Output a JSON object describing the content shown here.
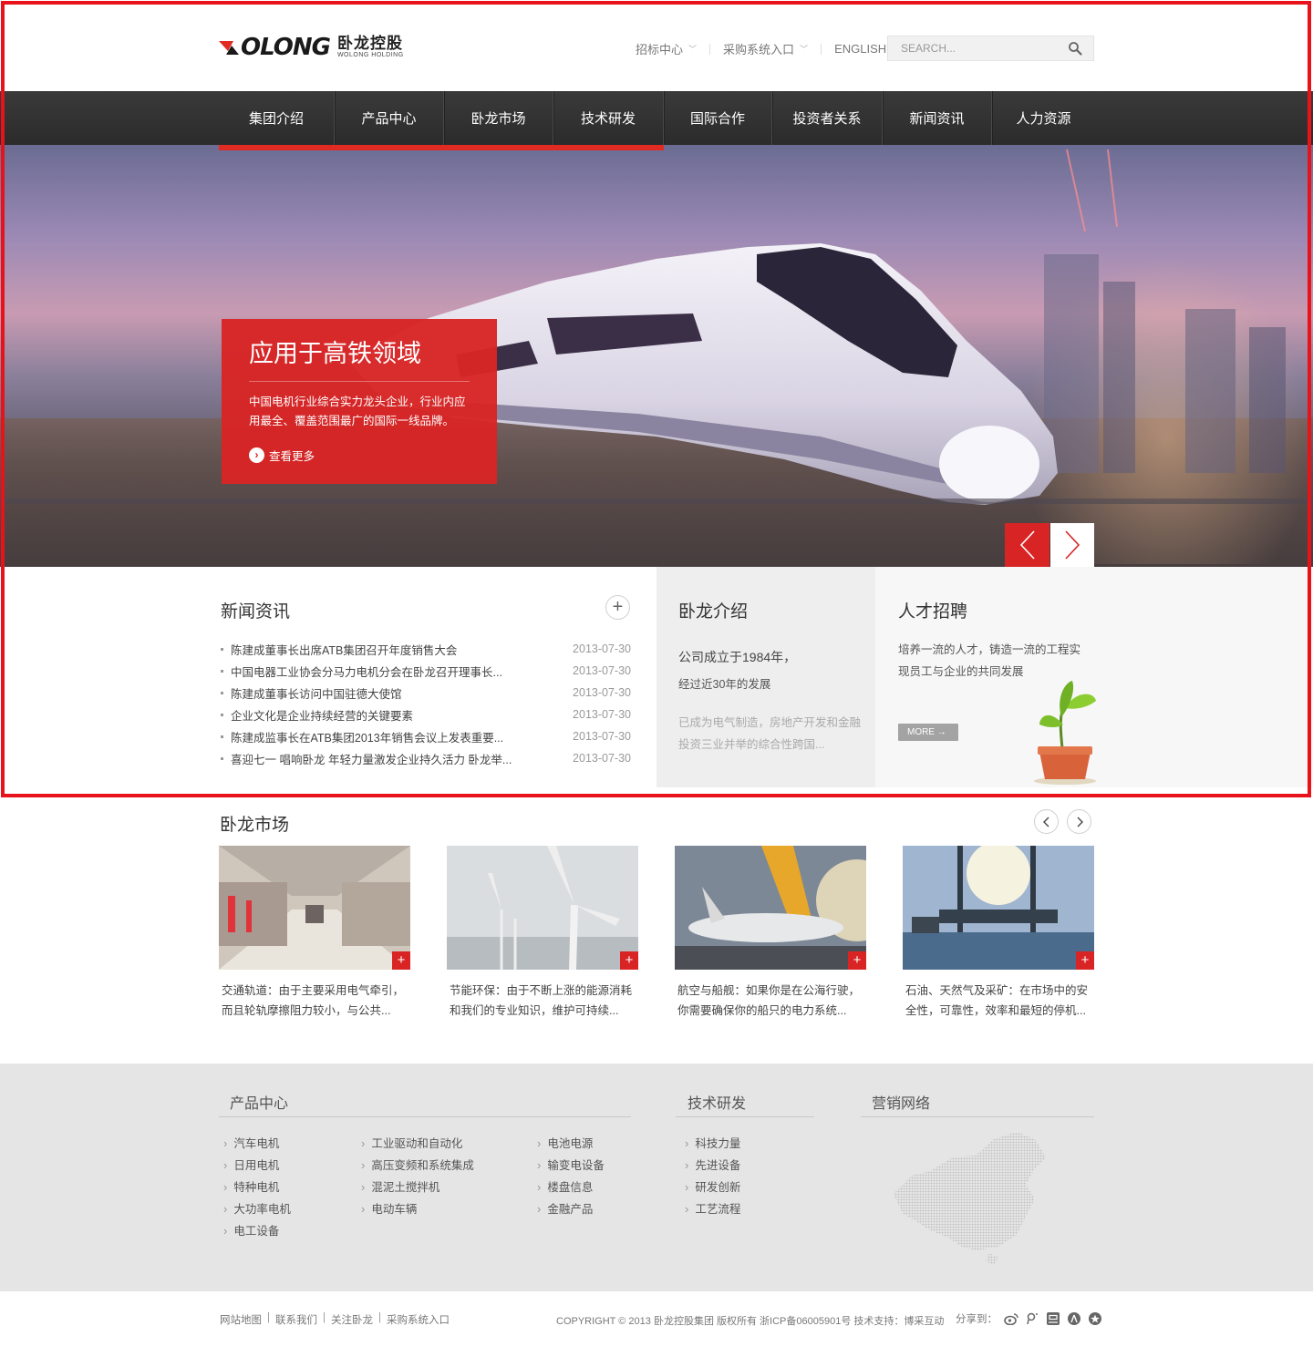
{
  "header": {
    "logo_text": "OLONG",
    "logo_cn": "卧龙控股",
    "logo_sub": "WOLONG HOLDING",
    "top_links": [
      {
        "label": "招标中心",
        "has_caret": true
      },
      {
        "label": "采购系统入口",
        "has_caret": true
      },
      {
        "label": "ENGLISH",
        "has_caret": false
      }
    ],
    "search_placeholder": "SEARCH..."
  },
  "nav": {
    "items": [
      "集团介绍",
      "产品中心",
      "卧龙市场",
      "技术研发",
      "国际合作",
      "投资者关系",
      "新闻资讯",
      "人力资源"
    ],
    "underline_fraction": 0.5
  },
  "banner": {
    "title": "应用于高铁领域",
    "text": "中国电机行业综合实力龙头企业，行业内应用最全、覆盖范围最广的国际一线品牌。",
    "more_label": "查看更多"
  },
  "news": {
    "title": "新闻资讯",
    "items": [
      {
        "title": "陈建成董事长出席ATB集团召开年度销售大会",
        "date": "2013-07-30"
      },
      {
        "title": "中国电器工业协会分马力电机分会在卧龙召开理事长...",
        "date": "2013-07-30"
      },
      {
        "title": "陈建成董事长访问中国驻德大使馆",
        "date": "2013-07-30"
      },
      {
        "title": "企业文化是企业持续经营的关键要素",
        "date": "2013-07-30"
      },
      {
        "title": "陈建成监事长在ATB集团2013年销售会议上发表重要...",
        "date": "2013-07-30"
      },
      {
        "title": "喜迎七一 唱响卧龙 年轻力量激发企业持久活力 卧龙举...",
        "date": "2013-07-30"
      }
    ]
  },
  "about": {
    "title": "卧龙介绍",
    "lead1": "公司成立于1984年，",
    "lead2": "经过近30年的发展",
    "text": "已成为电气制造，房地产开发和金融投资三业并举的综合性跨国..."
  },
  "jobs": {
    "title": "人才招聘",
    "text": "培养一流的人才，铸造一流的工程实现员工与企业的共同发展",
    "more_label": "MORE →"
  },
  "market": {
    "title": "卧龙市场",
    "cards": [
      {
        "text": "交通轨道：由于主要采用电气牵引，而且轮轨摩擦阻力较小，与公共..."
      },
      {
        "text": "节能环保：由于不断上涨的能源消耗和我们的专业知识，维护可持续..."
      },
      {
        "text": "航空与船舰：如果你是在公海行驶，你需要确保你的船只的电力系统..."
      },
      {
        "text": "石油、天然气及采矿：在市场中的安全性，可靠性，效率和最短的停机..."
      }
    ]
  },
  "footer": {
    "products_title": "产品中心",
    "products_col1": [
      "汽车电机",
      "日用电机",
      "特种电机",
      "大功率电机",
      "电工设备"
    ],
    "products_col2": [
      "工业驱动和自动化",
      "高压变频和系统集成",
      "混泥土搅拌机",
      "电动车辆"
    ],
    "products_col3": [
      "电池电源",
      "输变电设备",
      "楼盘信息",
      "金融产品"
    ],
    "tech_title": "技术研发",
    "tech_items": [
      "科技力量",
      "先进设备",
      "研发创新",
      "工艺流程"
    ],
    "network_title": "营销网络"
  },
  "bottom": {
    "links": [
      "网站地图",
      "联系我们",
      "关注卧龙",
      "采购系统入口"
    ],
    "copyright": "COPYRIGHT © 2013 卧龙控股集团 版权所有 浙ICP备06005901号 技术支持：博采互动",
    "share_label": "分享到："
  },
  "colors": {
    "accent": "#d82424",
    "nav_bg": "#333333",
    "footer_bg": "#e5e5e5"
  }
}
